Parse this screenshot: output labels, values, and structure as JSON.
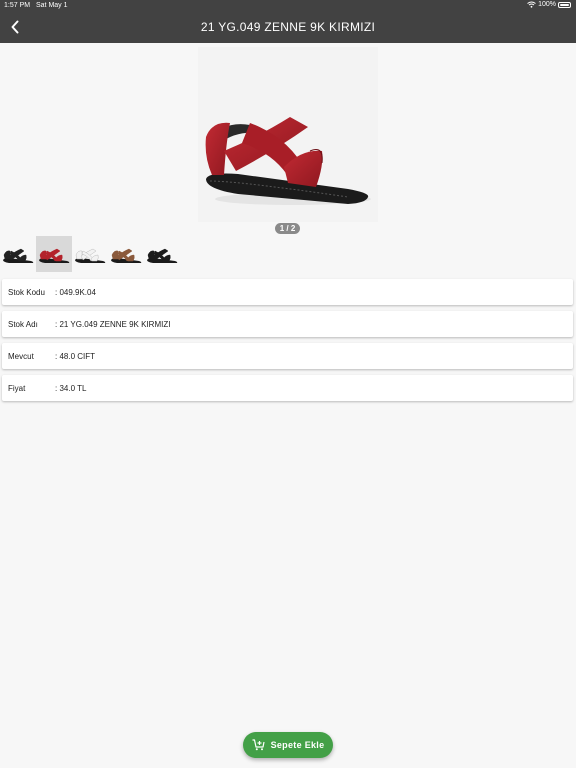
{
  "status_bar": {
    "time": "1:57 PM",
    "date": "Sat May 1",
    "battery": "100%"
  },
  "header": {
    "title": "21 YG.049 ZENNE 9K KIRMIZI",
    "back_icon": "chevron-left-icon"
  },
  "gallery": {
    "pager": "1 / 2",
    "thumbnails": [
      {
        "color": "#222222"
      },
      {
        "color": "#b3222b",
        "selected": true
      },
      {
        "color": "#f2f2f2"
      },
      {
        "color": "#8b5a3c"
      },
      {
        "color": "#1c1c1c"
      }
    ]
  },
  "details": [
    {
      "label": "Stok Kodu",
      "value": ": 049.9K.04"
    },
    {
      "label": "Stok Adı",
      "value": ": 21 YG.049 ZENNE 9K KIRMIZI"
    },
    {
      "label": "Mevcut",
      "value": ": 48.0 CIFT"
    },
    {
      "label": "Fiyat",
      "value": ": 34.0 TL"
    }
  ],
  "cart_button": {
    "label": "Sepete Ekle",
    "icon": "cart-add-icon"
  },
  "colors": {
    "app_bar": "#424242",
    "accent": "#43a047",
    "product": "#b3222b"
  }
}
